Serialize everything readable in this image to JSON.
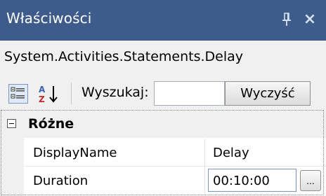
{
  "window": {
    "title": "Właściwości",
    "close_glyph": "×",
    "accent": "#3e5c8b"
  },
  "type_line": {
    "text": "System.Activities.Statements.Delay"
  },
  "toolbar": {
    "categorized_icon": "categorized-view-icon",
    "sort_icon": "sort-alphabetical-icon",
    "search_label": "Wyszukaj:",
    "search_value": "",
    "clear_label": "Wyczyść"
  },
  "grid": {
    "category": {
      "label": "Różne",
      "expanded": true
    },
    "properties": [
      {
        "name": "DisplayName",
        "value": "Delay"
      },
      {
        "name": "Duration",
        "value": "00:10:00",
        "button": "..."
      }
    ]
  }
}
